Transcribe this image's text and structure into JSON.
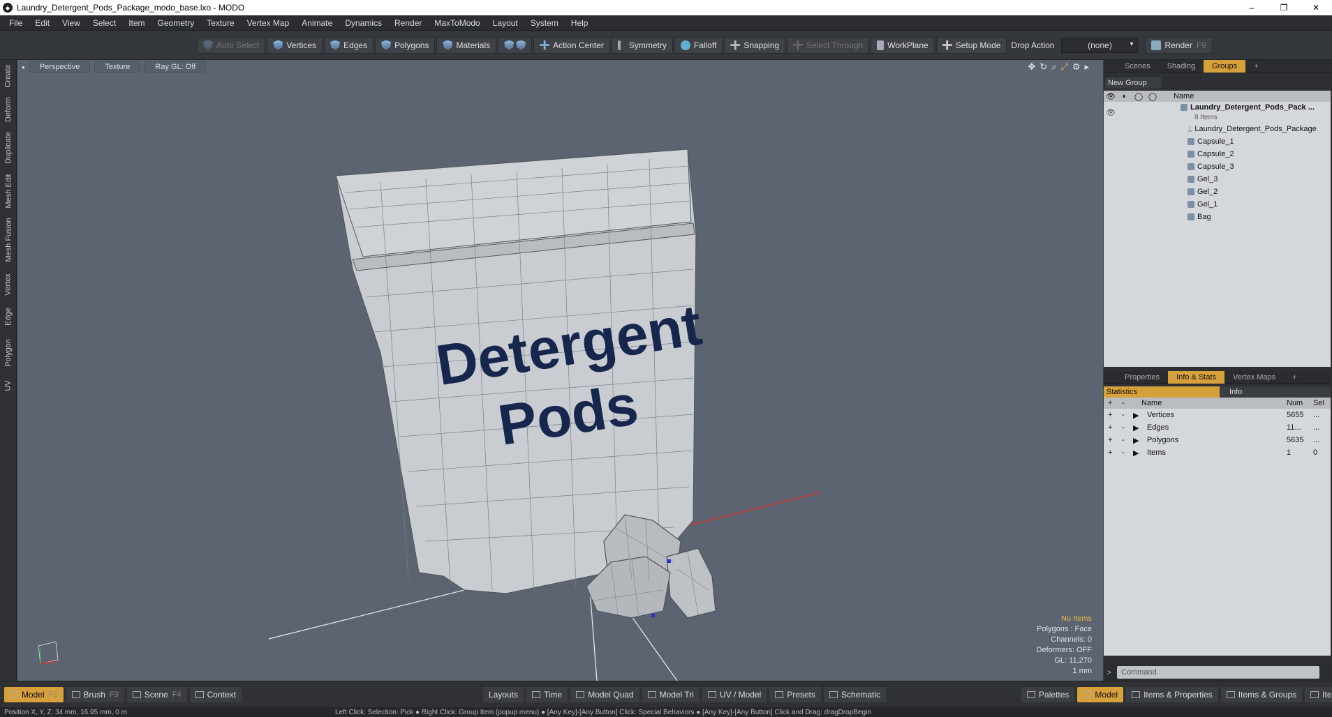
{
  "window": {
    "title": "Laundry_Detergent_Pods_Package_modo_base.lxo - MODO",
    "minimize": "–",
    "maximize": "❐",
    "close": "✕"
  },
  "menu": [
    "File",
    "Edit",
    "View",
    "Select",
    "Item",
    "Geometry",
    "Texture",
    "Vertex Map",
    "Animate",
    "Dynamics",
    "Render",
    "MaxToModo",
    "Layout",
    "System",
    "Help"
  ],
  "toolbar": {
    "auto_select": "Auto Select",
    "vertices": "Vertices",
    "edges": "Edges",
    "polygons": "Polygons",
    "materials": "Materials",
    "action_center": "Action Center",
    "symmetry": "Symmetry",
    "falloff": "Falloff",
    "snapping": "Snapping",
    "select_through": "Select Through",
    "workplane": "WorkPlane",
    "setup_mode": "Setup Mode",
    "drop_action": "Drop Action",
    "drop_value": "(none)",
    "render": "Render",
    "render_key": "F9"
  },
  "left_tabs": [
    "Create",
    "Deform",
    "Duplicate",
    "Mesh Edit",
    "Mesh Fusion",
    "Vertex",
    "Edge",
    "Polygon",
    "UV"
  ],
  "viewport": {
    "view": "Perspective",
    "shading": "Texture",
    "raygl": "Ray GL: Off",
    "bag_text_1": "Detergent",
    "bag_text_2": "Pods",
    "info": {
      "items": "No Items",
      "polygons": "Polygons : Face",
      "channels": "Channels: 0",
      "deformers": "Deformers: OFF",
      "gl": "GL: 11,270",
      "unit": "1 mm"
    }
  },
  "groups_panel": {
    "tabs": [
      "Scenes",
      "Shading",
      "Groups"
    ],
    "active_tab": "Groups",
    "new_group": "New Group",
    "col_name": "Name",
    "root": {
      "name": "Laundry_Detergent_Pods_Pack ...",
      "sub": "8 Items"
    },
    "items": [
      "Laundry_Detergent_Pods_Package",
      "Capsule_1",
      "Capsule_2",
      "Capsule_3",
      "Gel_3",
      "Gel_2",
      "Gel_1",
      "Bag"
    ]
  },
  "stats_panel": {
    "tabs": [
      "Properties",
      "Info & Stats",
      "Vertex Maps"
    ],
    "active_tab": "Info & Stats",
    "sub_tabs": [
      "Statistics",
      "Info"
    ],
    "headers": {
      "name": "Name",
      "num": "Num",
      "sel": "Sel"
    },
    "rows": [
      {
        "name": "Vertices",
        "num": "5655",
        "sel": "..."
      },
      {
        "name": "Edges",
        "num": "11...",
        "sel": "..."
      },
      {
        "name": "Polygons",
        "num": "5635",
        "sel": "..."
      },
      {
        "name": "Items",
        "num": "1",
        "sel": "0"
      }
    ],
    "command_placeholder": "Command"
  },
  "bottom_bar": {
    "left": [
      {
        "label": "Model",
        "key": "F2"
      },
      {
        "label": "Brush",
        "key": "F3"
      },
      {
        "label": "Scene",
        "key": "F4"
      },
      {
        "label": "Context",
        "key": ""
      }
    ],
    "center": [
      "Layouts",
      "Time",
      "Model Quad",
      "Model Tri",
      "UV / Model",
      "Presets",
      "Schematic"
    ],
    "right": [
      "Palettes",
      "Model",
      "Items & Properties",
      "Items & Groups",
      "Items & Shading"
    ]
  },
  "status": {
    "position": "Position X, Y, Z:  34 mm, 16.95 mm, 0 m",
    "hint": "Left Click: Selection: Pick ● Right Click: Group Item (popup menu) ● [Any Key]-[Any Button] Click: Special Behaviors ● [Any Key]-[Any Button] Click and Drag: dragDropBegin"
  }
}
